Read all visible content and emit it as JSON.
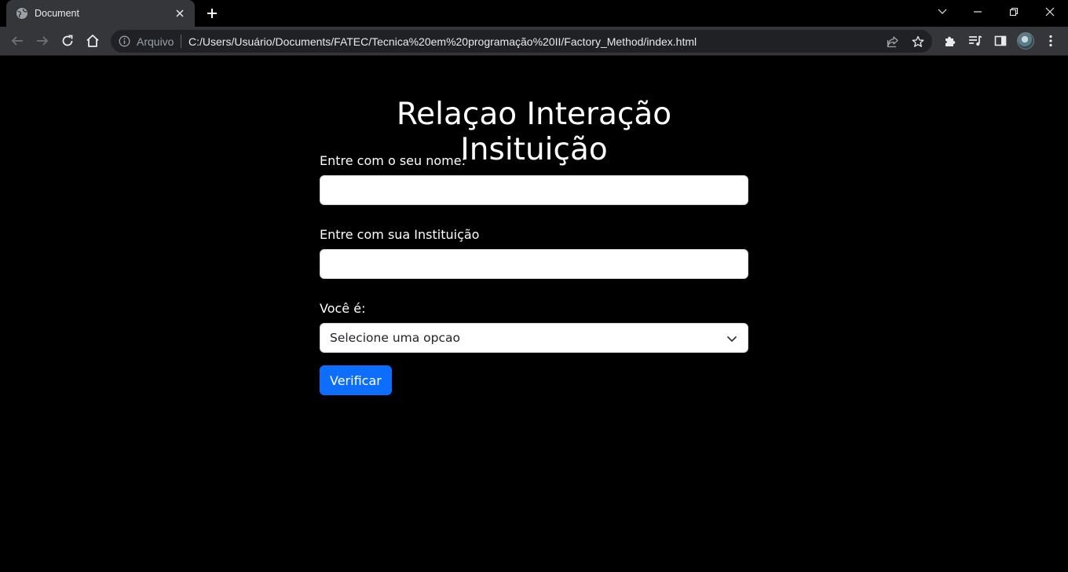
{
  "browser": {
    "tab": {
      "title": "Document"
    },
    "address": {
      "chip_label": "Arquivo",
      "url": "C:/Users/Usuário/Documents/FATEC/Tecnica%20em%20programação%20II/Factory_Method/index.html"
    }
  },
  "page": {
    "title": "Relaçao Interação Insituição",
    "form": {
      "name_label": "Entre com o seu nome:",
      "name_value": "",
      "institution_label": "Entre com sua Instituição",
      "institution_value": "",
      "role_label": "Você é:",
      "role_selected": "Selecione uma opcao",
      "submit_label": "Verificar"
    }
  },
  "colors": {
    "page_background": "#000000",
    "button_primary": "#0d6efd",
    "chrome_toolbar": "#35363a"
  }
}
